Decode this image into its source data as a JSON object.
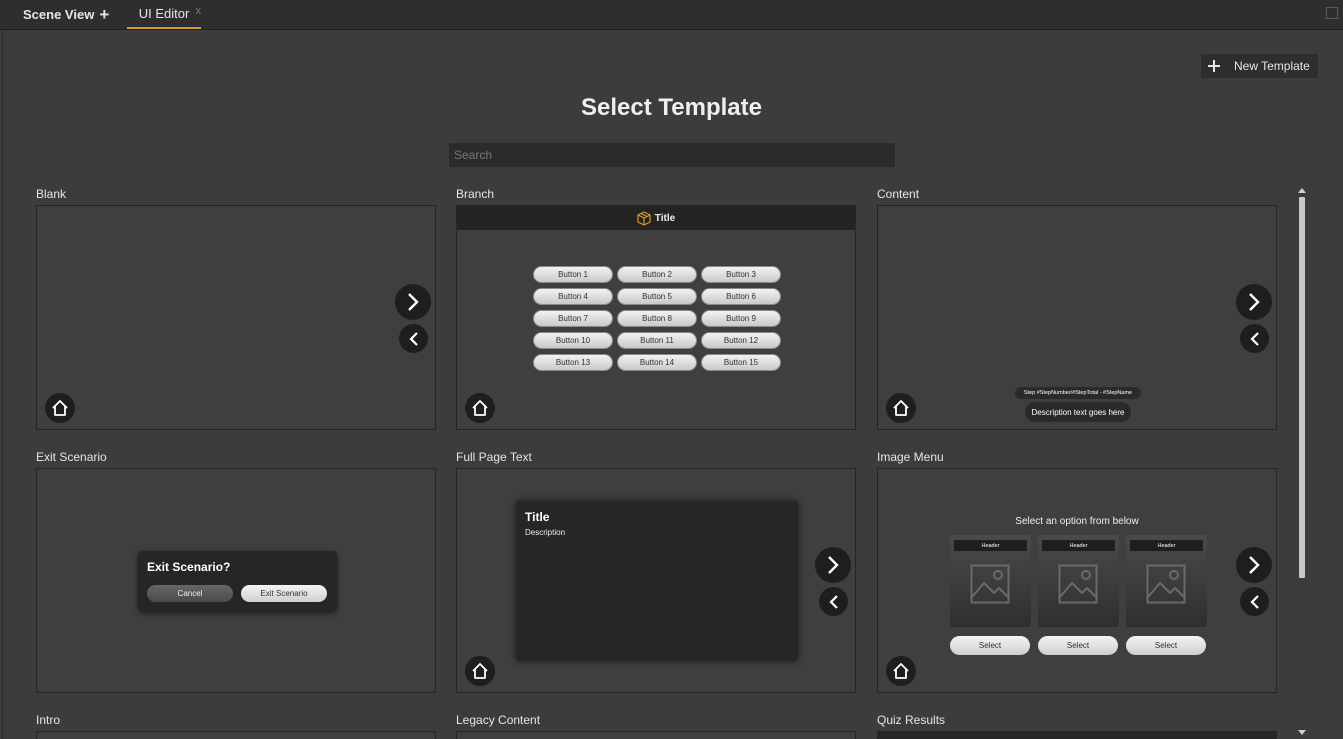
{
  "tabs": [
    {
      "label": "Scene View",
      "active": false
    },
    {
      "label": "UI Editor",
      "active": true,
      "close": "x"
    }
  ],
  "toolbar": {
    "new_template_label": "New Template"
  },
  "page_title": "Select Template",
  "search": {
    "placeholder": "Search",
    "value": ""
  },
  "colors": {
    "accent": "#d99a26",
    "background": "#3c3c3c",
    "panel": "#262626"
  },
  "templates": {
    "blank": {
      "label": "Blank"
    },
    "branch": {
      "label": "Branch",
      "header_title": "Title",
      "buttons": [
        "Button 1",
        "Button 2",
        "Button 3",
        "Button 4",
        "Button 5",
        "Button 6",
        "Button 7",
        "Button 8",
        "Button 9",
        "Button 10",
        "Button 11",
        "Button 12",
        "Button 13",
        "Button 14",
        "Button 15"
      ]
    },
    "content": {
      "label": "Content",
      "step_text": "Step #StepNumber/#StepTotal - #StepName",
      "description": "Description text goes here"
    },
    "exit_scenario": {
      "label": "Exit Scenario",
      "dialog_title": "Exit Scenario?",
      "cancel": "Cancel",
      "confirm": "Exit Scenario"
    },
    "full_page_text": {
      "label": "Full Page Text",
      "title": "Title",
      "description": "Description"
    },
    "image_menu": {
      "label": "Image Menu",
      "caption": "Select an option from below",
      "options": [
        {
          "header": "Header",
          "select": "Select"
        },
        {
          "header": "Header",
          "select": "Select"
        },
        {
          "header": "Header",
          "select": "Select"
        }
      ]
    },
    "intro": {
      "label": "Intro"
    },
    "legacy_content": {
      "label": "Legacy Content"
    },
    "quiz_results": {
      "label": "Quiz Results"
    }
  },
  "icons": {
    "home": "home-icon",
    "next": "chevron-right-icon",
    "prev": "chevron-left-icon",
    "cube": "cube-icon",
    "image": "image-placeholder-icon",
    "plus": "plus-icon"
  }
}
